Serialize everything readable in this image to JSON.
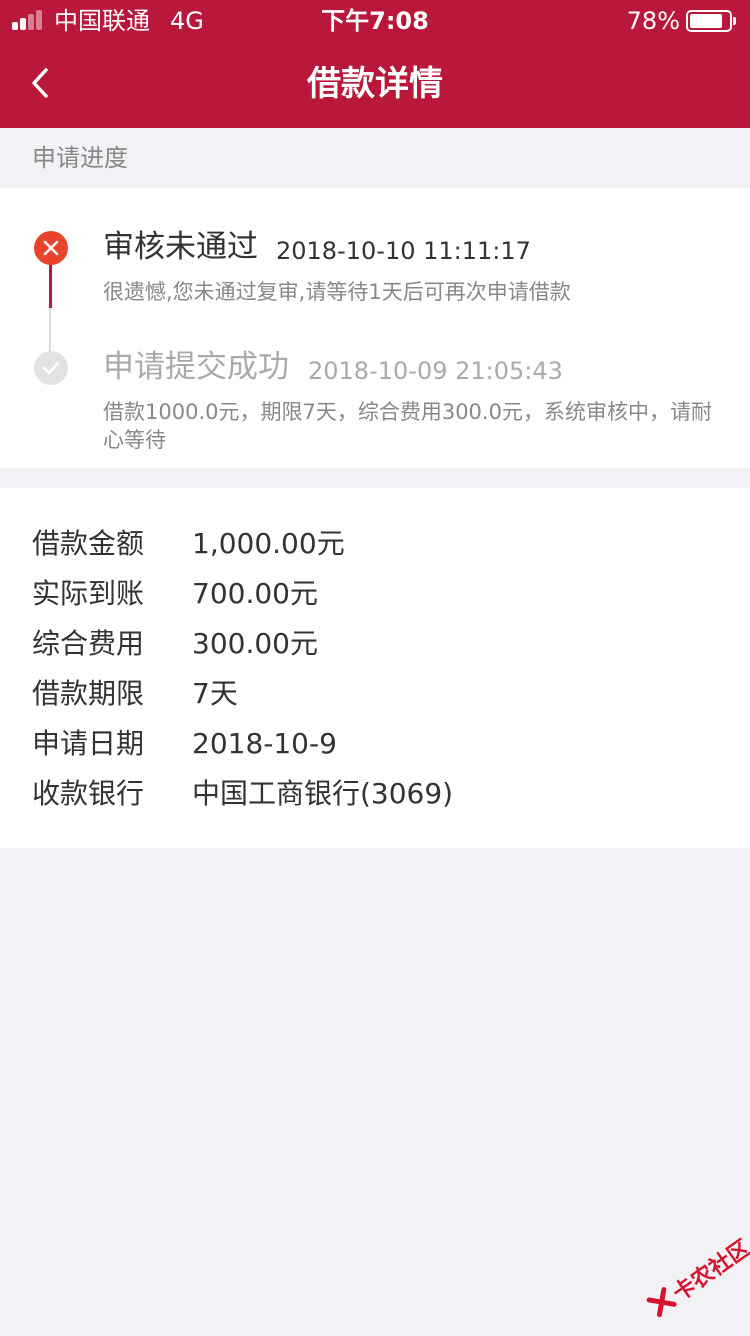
{
  "status_bar": {
    "carrier": "中国联通",
    "network": "4G",
    "time": "下午7:08",
    "battery": "78%"
  },
  "nav": {
    "title": "借款详情",
    "back_icon": "chevron-left-icon"
  },
  "progress_section": {
    "label": "申请进度",
    "steps": [
      {
        "title": "审核未通过",
        "time": "2018-10-10 11:11:17",
        "desc": "很遗憾,您未通过复审,请等待1天后可再次申请借款",
        "status": "failed",
        "icon": "close-circle-icon"
      },
      {
        "title": "申请提交成功",
        "time": "2018-10-09 21:05:43",
        "desc": "借款1000.0元，期限7天，综合费用300.0元，系统审核中，请耐心等待",
        "status": "done",
        "icon": "check-circle-icon"
      }
    ]
  },
  "details": [
    {
      "label": "借款金额",
      "value": "1,000.00元"
    },
    {
      "label": "实际到账",
      "value": "700.00元"
    },
    {
      "label": "综合费用",
      "value": "300.00元"
    },
    {
      "label": "借款期限",
      "value": "7天"
    },
    {
      "label": "申请日期",
      "value": "2018-10-9"
    },
    {
      "label": "收款银行",
      "value": "中国工商银行(3069)"
    }
  ],
  "watermark": "卡农社区",
  "colors": {
    "brand": "#b9183b",
    "fail": "#e8442c",
    "muted": "#888888"
  }
}
